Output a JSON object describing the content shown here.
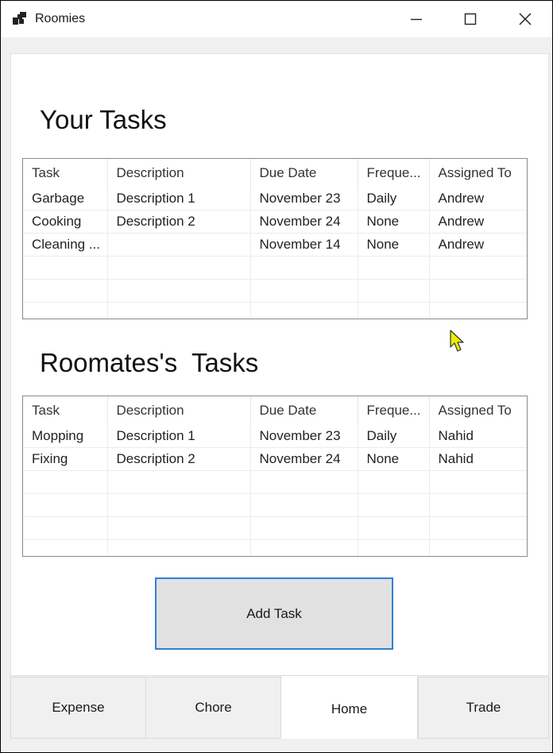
{
  "window": {
    "title": "Roomies",
    "icon": "app-icon",
    "controls": [
      "minimize-icon",
      "maximize-icon",
      "close-icon"
    ]
  },
  "your_tasks": {
    "title": "Your Tasks",
    "columns": [
      "Task",
      "Description",
      "Due Date",
      "Freque...",
      "Assigned To"
    ],
    "rows": [
      [
        "Garbage",
        "Description 1",
        "November 23",
        "Daily",
        "Andrew"
      ],
      [
        "Cooking",
        "Description 2",
        "November 24",
        "None",
        "Andrew"
      ],
      [
        "Cleaning ...",
        "",
        "November 14",
        "None",
        "Andrew"
      ]
    ]
  },
  "roommates_tasks": {
    "title": "Roomates's  Tasks",
    "columns": [
      "Task",
      "Description",
      "Due Date",
      "Freque...",
      "Assigned To"
    ],
    "rows": [
      [
        "Mopping",
        "Description 1",
        "November 23",
        "Daily",
        "Nahid"
      ],
      [
        "Fixing",
        "Description 2",
        "November 24",
        "None",
        "Nahid"
      ]
    ]
  },
  "add_task_button": {
    "label": "Add Task"
  },
  "tabs": [
    {
      "label": "Expense",
      "active": false
    },
    {
      "label": "Chore",
      "active": false
    },
    {
      "label": "Home",
      "active": true
    },
    {
      "label": "Trade",
      "active": false
    }
  ],
  "colors": {
    "accent": "#2f80d6",
    "button_face": "#e1e1e1",
    "cursor": "#e8f000"
  }
}
